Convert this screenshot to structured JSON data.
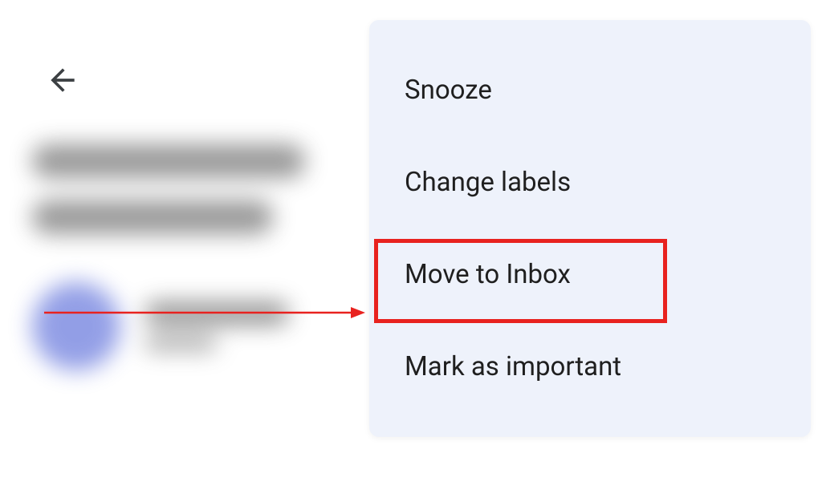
{
  "menu": {
    "items": [
      {
        "label": "Snooze"
      },
      {
        "label": "Change labels"
      },
      {
        "label": "Move to Inbox"
      },
      {
        "label": "Mark as important"
      }
    ]
  },
  "annotations": {
    "highlight_color": "#e8221f",
    "arrow_color": "#e8221f"
  }
}
